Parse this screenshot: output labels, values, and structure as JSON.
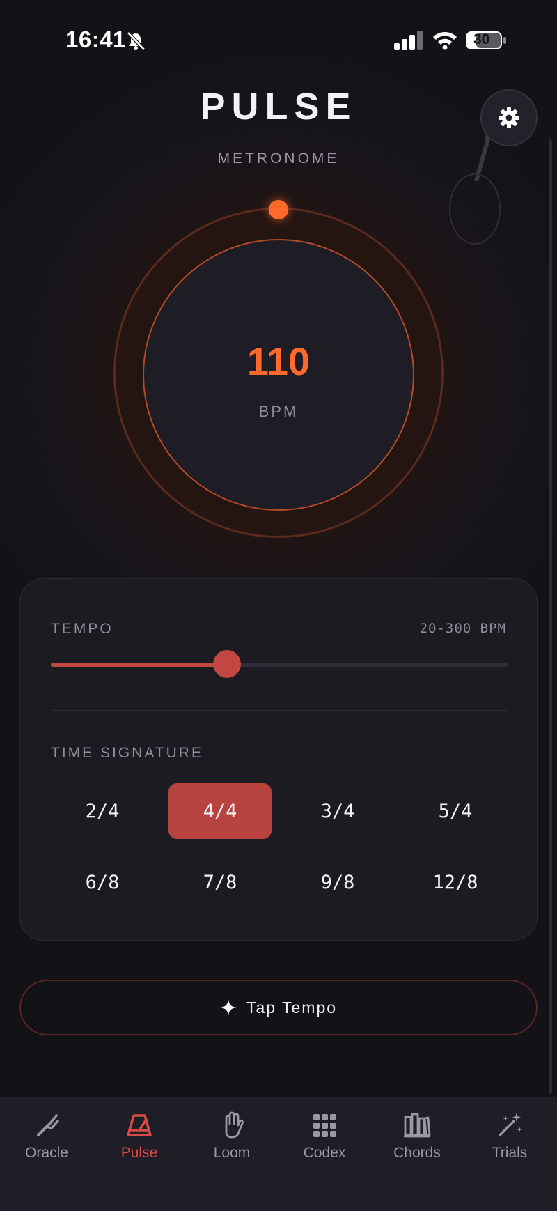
{
  "status_bar": {
    "time": "16:41",
    "battery": "30"
  },
  "header": {
    "title": "PULSE",
    "subtitle": "METRONOME"
  },
  "dial": {
    "bpm": "110",
    "unit": "BPM"
  },
  "tempo": {
    "label": "TEMPO",
    "range_label": "20-300 BPM",
    "min": 20,
    "max": 300,
    "value": 110
  },
  "time_signature": {
    "label": "TIME SIGNATURE",
    "options": [
      "2/4",
      "4/4",
      "3/4",
      "5/4",
      "6/8",
      "7/8",
      "9/8",
      "12/8"
    ],
    "selected": "4/4"
  },
  "tap_tempo": {
    "label": "Tap Tempo"
  },
  "tabs": [
    {
      "label": "Oracle",
      "icon": "tuning-fork-icon"
    },
    {
      "label": "Pulse",
      "icon": "metronome-icon"
    },
    {
      "label": "Loom",
      "icon": "hand-icon"
    },
    {
      "label": "Codex",
      "icon": "grid-icon"
    },
    {
      "label": "Chords",
      "icon": "library-icon"
    },
    {
      "label": "Trials",
      "icon": "magic-wand-icon"
    }
  ],
  "active_tab": "Pulse",
  "colors": {
    "accent": "#ff6a2c",
    "active_red": "#b84240",
    "background": "#141318",
    "card": "#1c1b22"
  }
}
